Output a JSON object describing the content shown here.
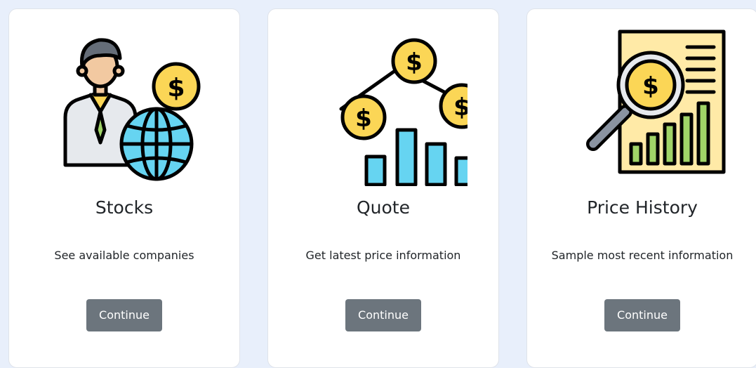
{
  "cards": [
    {
      "icon": "businessman-globe-coin-icon",
      "title": "Stocks",
      "description": "See available companies",
      "button_label": "Continue"
    },
    {
      "icon": "coins-bar-chart-icon",
      "title": "Quote",
      "description": "Get latest price information",
      "button_label": "Continue"
    },
    {
      "icon": "magnifier-report-chart-icon",
      "title": "Price History",
      "description": "Sample most recent information",
      "button_label": "Continue"
    }
  ],
  "colors": {
    "page_background": "#e8effb",
    "card_background": "#ffffff",
    "button_background": "#6c757d",
    "coin_yellow": "#fbd656",
    "globe_blue": "#66d4f1",
    "bar_green": "#a0d468",
    "paper_yellow": "#ffeaa7"
  }
}
